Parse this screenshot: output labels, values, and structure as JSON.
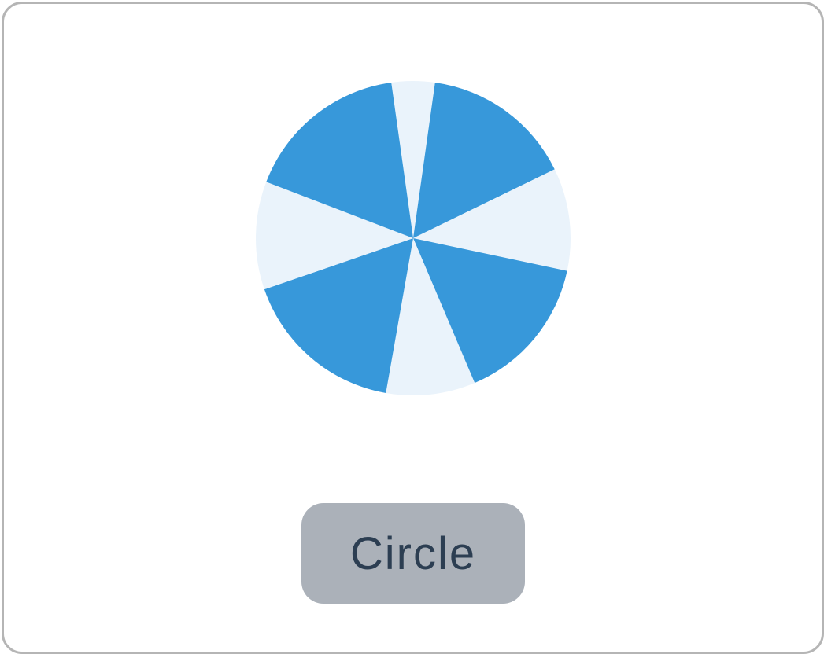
{
  "figure": {
    "shape": "circle",
    "colors": {
      "dark": "#3798da",
      "light": "#eaf3fb"
    },
    "sectors": [
      {
        "color": "light"
      },
      {
        "color": "dark"
      },
      {
        "color": "light"
      },
      {
        "color": "dark"
      },
      {
        "color": "light"
      },
      {
        "color": "dark"
      },
      {
        "color": "light"
      },
      {
        "color": "dark"
      }
    ]
  },
  "answer": {
    "label": "Circle"
  }
}
